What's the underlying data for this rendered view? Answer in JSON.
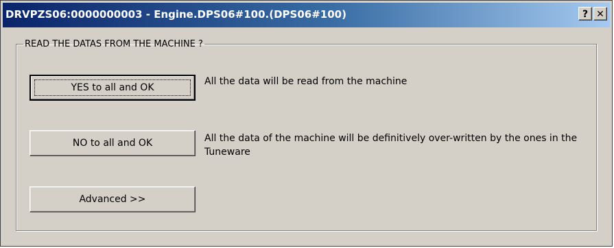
{
  "window": {
    "title": "DRVPZS06:0000000003 - Engine.DPS06#100.(DPS06#100)",
    "help_button": "?",
    "close_button": "✕"
  },
  "group": {
    "legend": "READ THE DATAS FROM THE MACHINE ?"
  },
  "options": {
    "yes": {
      "label": "YES to all and OK",
      "description": "All the data will be read from the machine"
    },
    "no": {
      "label": "NO to all and OK",
      "description": "All the data of the machine will be definitively over-written by the ones in the Tuneware"
    },
    "advanced": {
      "label": "Advanced >>"
    }
  }
}
